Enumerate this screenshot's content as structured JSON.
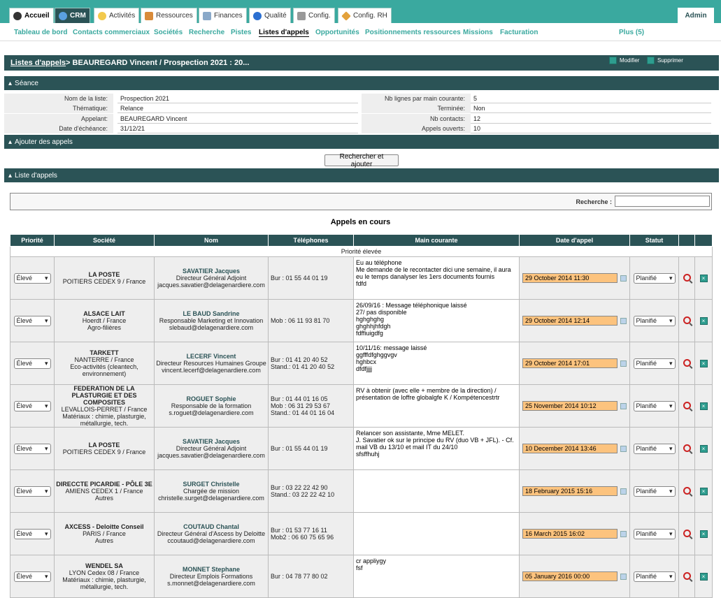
{
  "topnav": {
    "tabs": [
      {
        "label": "Accueil",
        "icon": "home-icon"
      },
      {
        "label": "CRM",
        "icon": "globe-icon"
      },
      {
        "label": "Activités",
        "icon": "clock-icon"
      },
      {
        "label": "Ressources",
        "icon": "people-icon"
      },
      {
        "label": "Finances",
        "icon": "chart-icon"
      },
      {
        "label": "Qualité",
        "icon": "info-icon"
      },
      {
        "label": "Config.",
        "icon": "tools-icon"
      },
      {
        "label": "Config. RH",
        "icon": "diamond-icon"
      }
    ],
    "admin": "Admin"
  },
  "subnav": {
    "items": [
      "Tableau de bord",
      "Contacts commerciaux",
      "Sociétés",
      "Recherche",
      "Pistes",
      "Listes d'appels",
      "Opportunités",
      "Positionnements ressources",
      "Missions",
      "Facturation"
    ],
    "plus": "Plus (5)"
  },
  "titlebar": {
    "link": "Listes d'appels",
    "rest": " > BEAUREGARD Vincent / Prospection 2021 : 20...",
    "modifier": "Modifier",
    "supprimer": "Supprimer"
  },
  "sections": {
    "seance": "Séance",
    "ajouter": "Ajouter des appels",
    "liste": "Liste d'appels"
  },
  "seance": {
    "left": [
      {
        "label": "Nom de la liste:",
        "value": "Prospection 2021"
      },
      {
        "label": "Thématique:",
        "value": "Relance"
      },
      {
        "label": "Appelant:",
        "value": "BEAUREGARD Vincent"
      },
      {
        "label": "Date d'échéance:",
        "value": "31/12/21"
      }
    ],
    "right": [
      {
        "label": "Nb lignes par main courante:",
        "value": "5"
      },
      {
        "label": "Terminée:",
        "value": "Non"
      },
      {
        "label": "Nb contacts:",
        "value": "12"
      },
      {
        "label": "Appels ouverts:",
        "value": "10"
      }
    ]
  },
  "rechercher_btn": "Rechercher et ajouter",
  "search_label": "Recherche :",
  "appels_title": "Appels en cours",
  "table": {
    "headers": [
      "Priorité",
      "Société",
      "Nom",
      "Téléphones",
      "Main courante",
      "Date d'appel",
      "Statut",
      "",
      ""
    ],
    "group": "Priorité élevée",
    "rows": [
      {
        "prio": "Élevé",
        "soc": [
          "LA POSTE",
          "POITIERS CEDEX 9 / France"
        ],
        "nom": "SAVATIER Jacques",
        "nom_lines": [
          "Directeur Général Adjoint",
          "jacques.savatier@delagenardiere.com"
        ],
        "tel": [
          "Bur : 01 55 44 01 19"
        ],
        "mc": "Eu au téléphone\nMe demande de le recontacter dici une semaine, il aura eu le temps danalyser les 1ers documents fournis\nfdfd",
        "date": "29 October 2014 11:30",
        "statut": "Planifié"
      },
      {
        "prio": "Élevé",
        "soc": [
          "ALSACE LAIT",
          "Hoerdt / France",
          "Agro-filières"
        ],
        "nom": "LE BAUD Sandrine",
        "nom_lines": [
          "Responsable Marketing et Innovation",
          "slebaud@delagenardiere.com"
        ],
        "tel": [
          "Mob : 06 11 93 81 70"
        ],
        "mc": "26/09/16 : Message téléphonique laissé\n27/ pas disponible\nhghghghg\nghghhjhfdgh\nfdffiuigdfg",
        "date": "29 October 2014 12:14",
        "statut": "Planifié"
      },
      {
        "prio": "Élevé",
        "soc": [
          "TARKETT",
          "NANTERRE / France",
          "Eco-activités (cleantech, environnement)"
        ],
        "nom": "LECERF Vincent",
        "nom_lines": [
          "Directeur Resources Humaines Groupe",
          "vincent.lecerf@delagenardiere.com"
        ],
        "tel": [
          "Bur : 01 41 20 40 52",
          "Stand.: 01 41 20 40 52"
        ],
        "mc": "10/11/16: message laissé\nggfffdfghggvgv\nhghbcx\ndfdfjjjj",
        "date": "29 October 2014 17:01",
        "statut": "Planifié"
      },
      {
        "prio": "Élevé",
        "soc": [
          "FEDERATION DE LA PLASTURGIE ET DES COMPOSITES",
          "LEVALLOIS-PERRET / France",
          "Matériaux : chimie, plasturgie, métallurgie, tech."
        ],
        "nom": "ROGUET Sophie",
        "nom_lines": [
          "Responsable de la formation",
          "s.roguet@delagenardiere.com"
        ],
        "tel": [
          "Bur : 01 44 01 16 05",
          "Mob : 06 31 29 53 67",
          "Stand.: 01 44 01 16 04"
        ],
        "mc": "RV à obtenir (avec elle + membre de la direction) / présentation de loffre globalgfe K / Kompétencestrtr",
        "date": "25 November 2014 10:12",
        "statut": "Planifié"
      },
      {
        "prio": "Élevé",
        "soc": [
          "LA POSTE",
          "POITIERS CEDEX 9 / France"
        ],
        "nom": "SAVATIER Jacques",
        "nom_lines": [
          "Directeur Général Adjoint",
          "jacques.savatier@delagenardiere.com"
        ],
        "tel": [
          "Bur : 01 55 44 01 19"
        ],
        "mc": "Relancer son assistante, Mme MELET.\nJ. Savatier ok sur le principe du RV (duo VB + JFL). - Cf. mail VB du 13/10 et mail IT du 24/10\nsfsffhuhj",
        "date": "10 December 2014 13:46",
        "statut": "Planifié"
      },
      {
        "prio": "Élevé",
        "soc": [
          "DIRECCTE PICARDIE - PÔLE 3E",
          "AMIENS CEDEX 1 / France",
          "Autres"
        ],
        "nom": "SURGET Christelle",
        "nom_lines": [
          "Chargée de mission",
          "christelle.surget@delagenardiere.com"
        ],
        "tel": [
          "Bur : 03 22 22 42 90",
          "Stand.: 03 22 22 42 10"
        ],
        "mc": "",
        "date": "18 February 2015 15:16",
        "statut": "Planifié"
      },
      {
        "prio": "Élevé",
        "soc": [
          "AXCESS - Deloitte Conseil",
          "PARIS / France",
          "Autres"
        ],
        "nom": "COUTAUD Chantal",
        "nom_lines": [
          "Directeur Général d'Ascess by Deloitte",
          "ccoutaud@delagenardiere.com"
        ],
        "tel": [
          "Bur : 01 53 77 16 11",
          "Mob2 : 06 60 75 65 96"
        ],
        "mc": "",
        "date": "16 March 2015 16:02",
        "statut": "Planifié"
      },
      {
        "prio": "Élevé",
        "soc": [
          "WENDEL SA",
          "LYON Cedex 08 / France",
          "Matériaux : chimie, plasturgie, métallurgie, tech."
        ],
        "nom": "MONNET Stephane",
        "nom_lines": [
          "Directeur Emplois Formations",
          "s.monnet@delagenardiere.com"
        ],
        "tel": [
          "Bur : 04 78 77 80 02"
        ],
        "mc": "cr appliygy\nfsf",
        "date": "05 January 2016 00:00",
        "statut": "Planifié"
      }
    ]
  }
}
